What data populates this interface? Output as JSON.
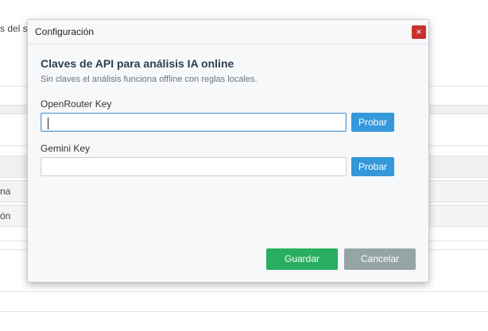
{
  "background": {
    "fragments": [
      "s del sis",
      "na",
      "ón"
    ]
  },
  "dialog": {
    "title": "Configuración",
    "close_label": "×",
    "heading": "Claves de API para análisis IA online",
    "subheading": "Sin claves el análisis funciona offline con reglas locales.",
    "fields": [
      {
        "label": "OpenRouter Key",
        "value": "",
        "placeholder": "",
        "test_label": "Probar"
      },
      {
        "label": "Gemini Key",
        "value": "",
        "placeholder": "",
        "test_label": "Probar"
      }
    ],
    "save_label": "Guardar",
    "cancel_label": "Cancelar"
  },
  "colors": {
    "accent": "#3498db",
    "save": "#27ae60",
    "cancel": "#95a5a6",
    "close": "#c9302c"
  }
}
